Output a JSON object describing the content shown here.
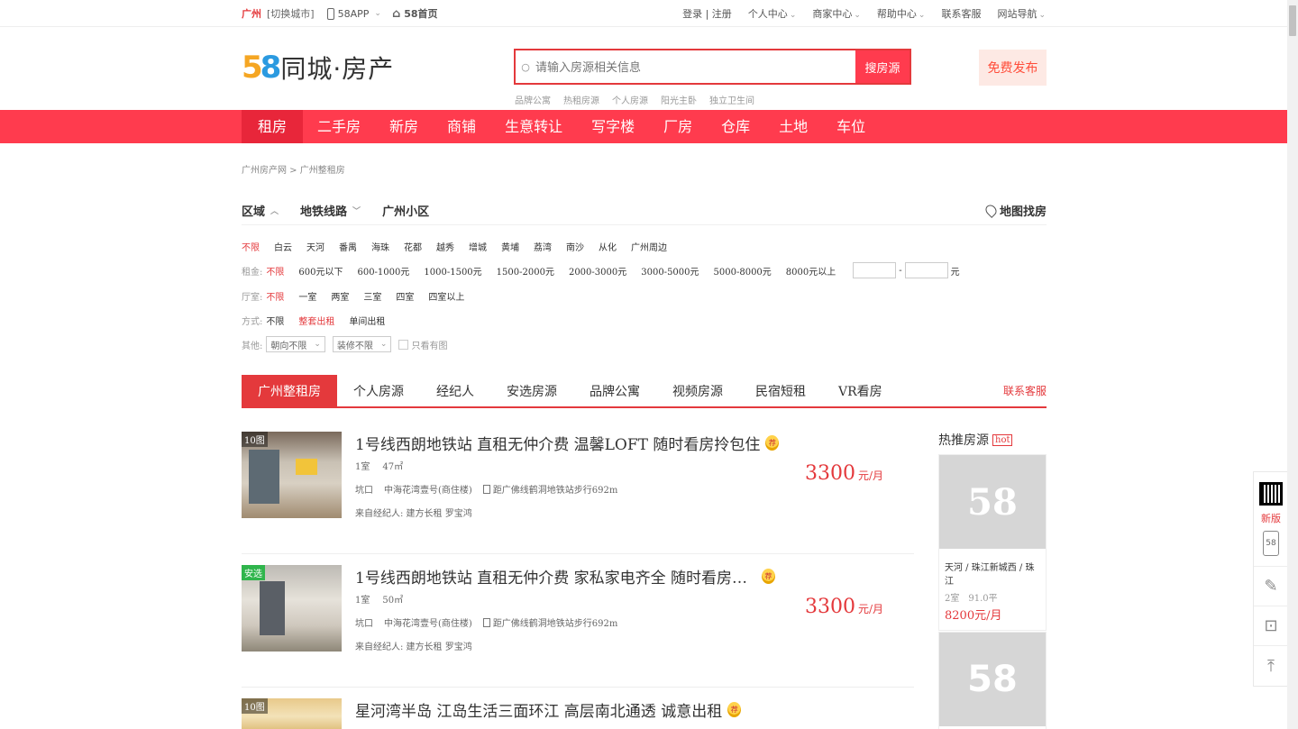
{
  "topbar": {
    "city": "广州",
    "switch_city": "[切换城市]",
    "app": "58APP",
    "home": "58首页",
    "links": [
      "登录 | 注册",
      "个人中心",
      "商家中心",
      "帮助中心",
      "联系客服",
      "网站导航"
    ]
  },
  "header": {
    "logo_digits_5": "5",
    "logo_digits_8": "8",
    "logo_text": "同城·房产",
    "search_placeholder": "请输入房源相关信息",
    "search_button": "搜房源",
    "hot_words": [
      "品牌公寓",
      "热租房源",
      "个人房源",
      "阳光主卧",
      "独立卫生间"
    ],
    "publish": "免费发布"
  },
  "nav": [
    "租房",
    "二手房",
    "新房",
    "商铺",
    "生意转让",
    "写字楼",
    "厂房",
    "仓库",
    "土地",
    "车位"
  ],
  "breadcrumb": "广州房产网 > 广州整租房",
  "filter_head": {
    "region": "区域",
    "metro": "地铁线路",
    "community": "广州小区",
    "map": "地图找房"
  },
  "areas": [
    "不限",
    "白云",
    "天河",
    "番禺",
    "海珠",
    "花都",
    "越秀",
    "增城",
    "黄埔",
    "荔湾",
    "南沙",
    "从化",
    "广州周边"
  ],
  "rent": {
    "label": "租金:",
    "options": [
      "不限",
      "600元以下",
      "600-1000元",
      "1000-1500元",
      "1500-2000元",
      "2000-3000元",
      "3000-5000元",
      "5000-8000元",
      "8000元以上"
    ],
    "dash": "-",
    "unit": "元"
  },
  "rooms": {
    "label": "厅室:",
    "options": [
      "不限",
      "一室",
      "两室",
      "三室",
      "四室",
      "四室以上"
    ]
  },
  "mode": {
    "label": "方式:",
    "options": [
      "不限",
      "整套出租",
      "单间出租"
    ]
  },
  "other": {
    "label": "其他:",
    "orientation": "朝向不限",
    "decoration": "装修不限",
    "with_image": "只看有图"
  },
  "tabs": [
    "广州整租房",
    "个人房源",
    "经纪人",
    "安选房源",
    "品牌公寓",
    "视频房源",
    "民宿短租",
    "VR看房"
  ],
  "service": "联系客服",
  "listings": [
    {
      "badge": "10图",
      "title": "1号线西朗地铁站 直租无仲介费 温馨LOFT 随时看房拎包住",
      "medal": "荐",
      "room": "1室",
      "area": "47㎡",
      "district": "坑口",
      "community": "中海花湾壹号(商住楼)",
      "metro": "距广佛线鹤洞地铁站步行692m",
      "agent": "来自经纪人: 建方长租 罗宝鸿",
      "price": "3300",
      "price_unit": "元/月"
    },
    {
      "badge": "安选",
      "title": "1号线西朗地铁站 直租无仲介费 家私家电齐全 随时看房…",
      "medal": "荐",
      "room": "1室",
      "area": "50㎡",
      "district": "坑口",
      "community": "中海花湾壹号(商住楼)",
      "metro": "距广佛线鹤洞地铁站步行692m",
      "agent": "来自经纪人: 建方长租 罗宝鸿",
      "price": "3300",
      "price_unit": "元/月"
    },
    {
      "badge": "10图",
      "title": "星河湾半岛 江岛生活三面环江 高层南北通透 诚意出租",
      "medal": "荐"
    }
  ],
  "hot": {
    "title": "热推房源",
    "tag": "hot",
    "cards": [
      {
        "img_text": "58",
        "location": "天河 / 珠江新城西 / 珠江",
        "spec": "2室　91.0平",
        "price": "8200元/月"
      },
      {
        "img_text": "58"
      }
    ]
  },
  "sidebar": {
    "new_label": "新版",
    "phone_text": "58"
  }
}
